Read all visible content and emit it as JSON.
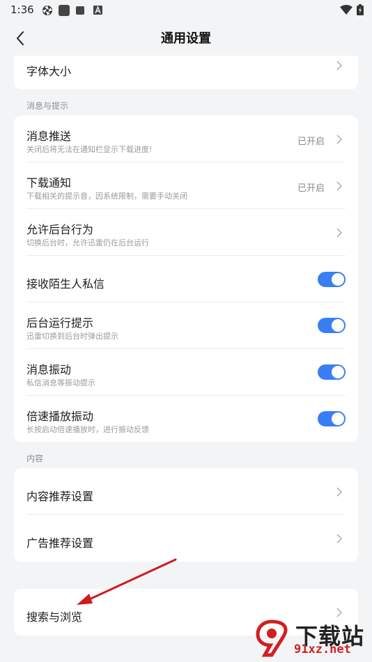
{
  "status": {
    "time": "1:36",
    "icons": [
      "aperture-icon",
      "square-icon",
      "stop-icon",
      "font-a-icon",
      "wifi-icon",
      "battery-icon"
    ]
  },
  "header": {
    "title": "通用设置"
  },
  "card_font": {
    "title": "字体大小"
  },
  "section_messages": {
    "label": "消息与提示"
  },
  "messages": [
    {
      "title": "消息推送",
      "sub": "关闭后将无法在通知栏显示下载进度!",
      "value": "已开启",
      "kind": "chevron"
    },
    {
      "title": "下载通知",
      "sub": "下载相关的提示音，因系统限制，需要手动关闭",
      "value": "已开启",
      "kind": "chevron"
    },
    {
      "title": "允许后台行为",
      "sub": "切换后台时，允许迅雷仍在后台运行",
      "value": "",
      "kind": "chevron"
    },
    {
      "title": "接收陌生人私信",
      "sub": "",
      "value": "",
      "kind": "toggle",
      "on": true
    },
    {
      "title": "后台运行提示",
      "sub": "迅雷切换到后台时弹出提示",
      "value": "",
      "kind": "toggle",
      "on": true
    },
    {
      "title": "消息振动",
      "sub": "私信消息等振动提示",
      "value": "",
      "kind": "toggle",
      "on": true
    },
    {
      "title": "倍速播放振动",
      "sub": "长按启动倍速播放时，进行振动反馈",
      "value": "",
      "kind": "toggle",
      "on": true
    }
  ],
  "section_content": {
    "label": "内容"
  },
  "content": [
    {
      "title": "内容推荐设置"
    },
    {
      "title": "广告推荐设置"
    }
  ],
  "card_search": {
    "title": "搜索与浏览"
  },
  "watermark": {
    "brand": "下载站",
    "url": "91xz.net"
  },
  "colors": {
    "accent": "#3a7ef5",
    "annotation_arrow": "#d0191e",
    "background": "#f3f4f6"
  }
}
